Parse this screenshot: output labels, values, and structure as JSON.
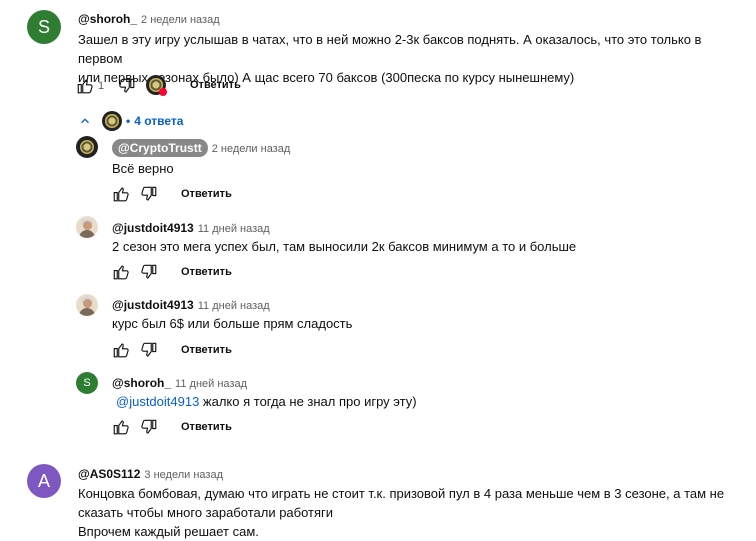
{
  "comments": [
    {
      "author": "@shoroh_",
      "time": "2 недели назад",
      "avatar_letter": "S",
      "text_lines": [
        "Зашел в эту игру услышав в чатах, что в ней можно 2-3к баксов поднять. А оказалось, что это только в первом",
        "или первых сезонах было) А щас всего 70 баксов (300песка по курсу нынешнему)"
      ],
      "likes": "1",
      "reply_label": "Ответить",
      "replies_toggle": "4 ответа"
    },
    {
      "author": "@AS0S112",
      "time": "3 недели назад",
      "avatar_letter": "A",
      "text_lines": [
        "Концовка бомбовая, думаю что играть не стоит т.к. призовой пул в 4 раза меньше чем в 3 сезоне,  а там не",
        "сказать чтобы много заработали работяги",
        "Впрочем каждый решает сам."
      ]
    }
  ],
  "replies": [
    {
      "author": "@CryptoTrustt",
      "time": "2 недели назад",
      "text": "Всё верно",
      "reply_label": "Ответить",
      "avatar": "coin-avatar"
    },
    {
      "author": "@justdoit4913",
      "time": "11 дней назад",
      "text": "2 сезон это мега успех был, там выносили 2к баксов минимум а то и больше",
      "reply_label": "Ответить",
      "avatar": "man-avatar"
    },
    {
      "author": "@justdoit4913",
      "time": "11 дней назад",
      "text": "курс был 6$ или больше прям сладость",
      "reply_label": "Ответить",
      "avatar": "man-avatar"
    },
    {
      "author": "@shoroh_",
      "time": "11 дней назад",
      "mention": "@justdoit4913",
      "text": " жалко я тогда не знал про игру эту)",
      "reply_label": "Ответить",
      "avatar_letter": "S"
    }
  ],
  "colors": {
    "link": "#065fd4",
    "green_avatar": "#2e7d32",
    "purple_avatar": "#7e57c2",
    "heart": "#ff0033"
  }
}
